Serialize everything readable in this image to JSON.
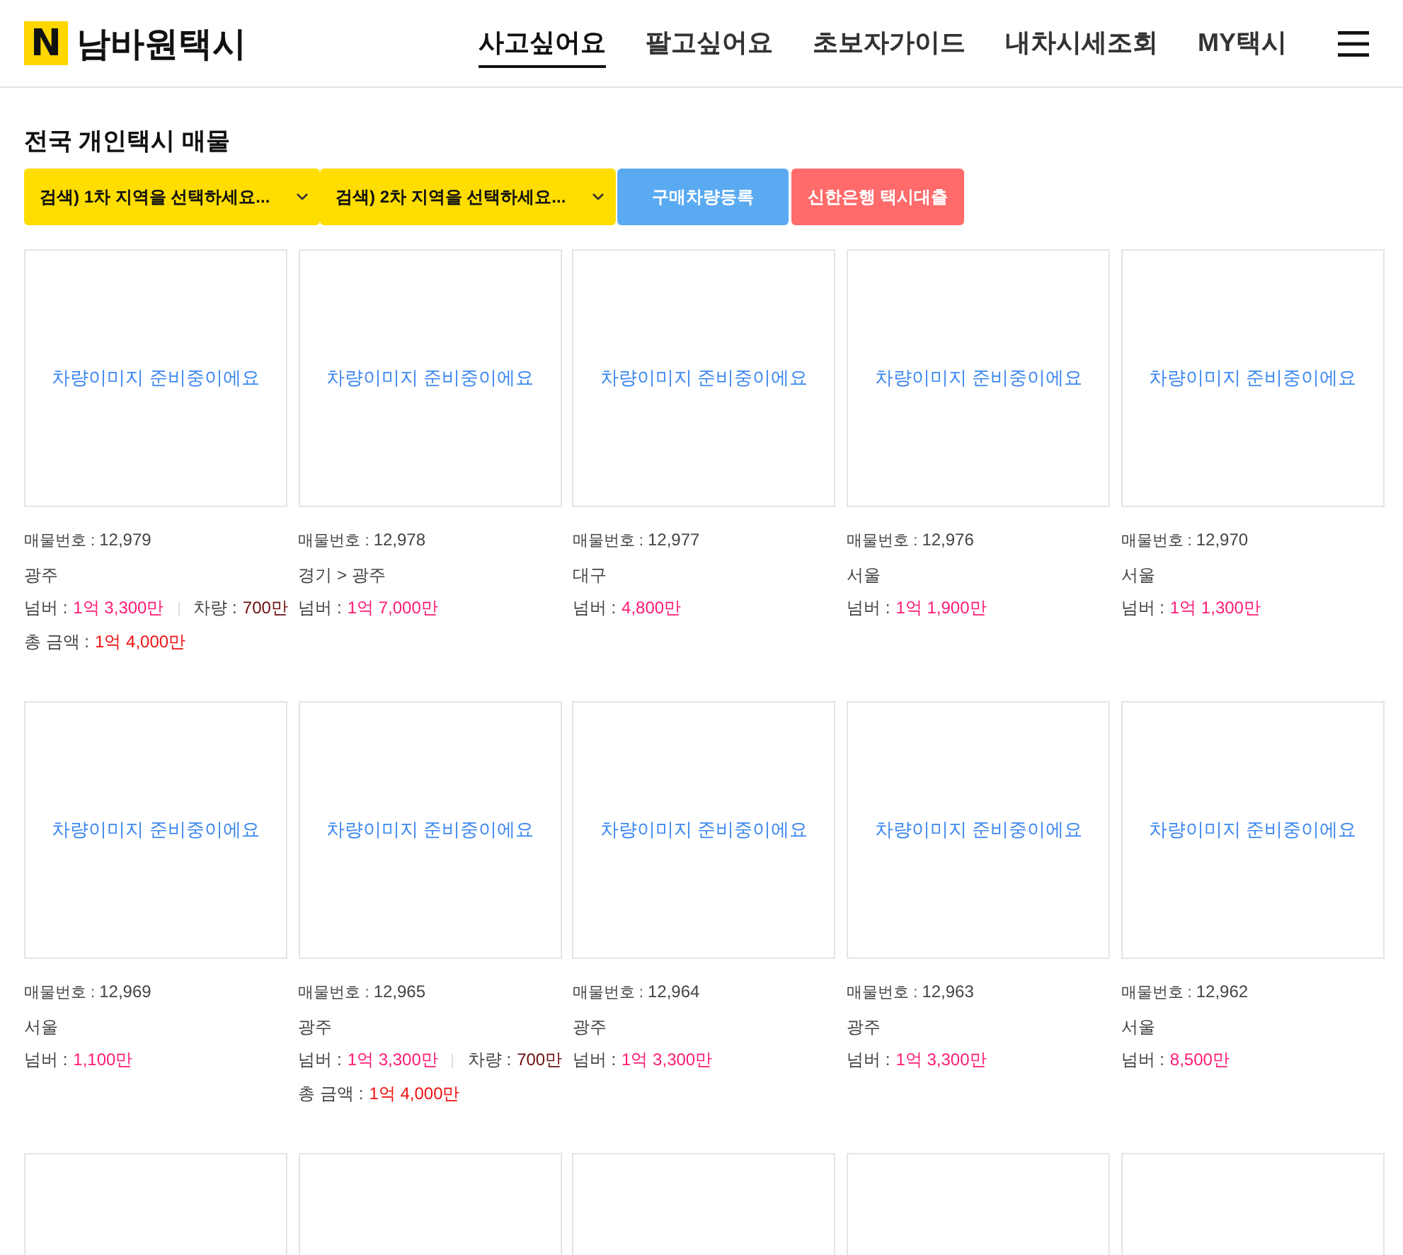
{
  "header": {
    "logo_mark": "N",
    "logo_text": "남바원택시",
    "nav": [
      {
        "label": "사고싶어요",
        "selected": true
      },
      {
        "label": "팔고싶어요",
        "selected": false
      },
      {
        "label": "초보자가이드",
        "selected": false
      },
      {
        "label": "내차시세조회",
        "selected": false
      },
      {
        "label": "MY택시",
        "selected": false
      }
    ]
  },
  "page_title": "전국 개인택시 매물",
  "filters": [
    {
      "kind": "select",
      "label": "검색)  1차 지역을 선택하세요..."
    },
    {
      "kind": "select",
      "label": "검색)  2차 지역을 선택하세요..."
    },
    {
      "kind": "primary",
      "label": "구매차량등록"
    },
    {
      "kind": "danger",
      "label": "신한은행 택시대출"
    }
  ],
  "listings": [
    {
      "kind": "full",
      "image_text": "차량이미지 준비중이에요",
      "number_label": "매물번호 :",
      "number": "12,979",
      "region": "광주",
      "plate_label": "넘버 :",
      "plate_price": "1억 3,300만",
      "vehicle_label": "차량 :",
      "vehicle_price": "700만",
      "total_label": "총 금액 :",
      "total_price": "1억 4,000만"
    },
    {
      "kind": "full",
      "image_text": "차량이미지 준비중이에요",
      "number_label": "매물번호 :",
      "number": "12,978",
      "region": "경기 > 광주",
      "plate_label": "넘버 :",
      "plate_price": "1억 7,000만"
    },
    {
      "kind": "full",
      "image_text": "차량이미지 준비중이에요",
      "number_label": "매물번호 :",
      "number": "12,977",
      "region": "대구",
      "plate_label": "넘버 :",
      "plate_price": "4,800만"
    },
    {
      "kind": "full",
      "image_text": "차량이미지 준비중이에요",
      "number_label": "매물번호 :",
      "number": "12,976",
      "region": "서울",
      "plate_label": "넘버 :",
      "plate_price": "1억 1,900만"
    },
    {
      "kind": "full",
      "image_text": "차량이미지 준비중이에요",
      "number_label": "매물번호 :",
      "number": "12,970",
      "region": "서울",
      "plate_label": "넘버 :",
      "plate_price": "1억 1,300만"
    },
    {
      "kind": "full",
      "image_text": "차량이미지 준비중이에요",
      "number_label": "매물번호 :",
      "number": "12,969",
      "region": "서울",
      "plate_label": "넘버 :",
      "plate_price": "1,100만"
    },
    {
      "kind": "full",
      "image_text": "차량이미지 준비중이에요",
      "number_label": "매물번호 :",
      "number": "12,965",
      "region": "광주",
      "plate_label": "넘버 :",
      "plate_price": "1억 3,300만",
      "vehicle_label": "차량 :",
      "vehicle_price": "700만",
      "total_label": "총 금액 :",
      "total_price": "1억 4,000만"
    },
    {
      "kind": "full",
      "image_text": "차량이미지 준비중이에요",
      "number_label": "매물번호 :",
      "number": "12,964",
      "region": "광주",
      "plate_label": "넘버 :",
      "plate_price": "1억 3,300만"
    },
    {
      "kind": "full",
      "image_text": "차량이미지 준비중이에요",
      "number_label": "매물번호 :",
      "number": "12,963",
      "region": "광주",
      "plate_label": "넘버 :",
      "plate_price": "1억 3,300만"
    },
    {
      "kind": "full",
      "image_text": "차량이미지 준비중이에요",
      "number_label": "매물번호 :",
      "number": "12,962",
      "region": "서울",
      "plate_label": "넘버 :",
      "plate_price": "8,500만"
    },
    {
      "kind": "cut"
    },
    {
      "kind": "cut"
    },
    {
      "kind": "cut"
    },
    {
      "kind": "cut"
    },
    {
      "kind": "cut"
    }
  ]
}
